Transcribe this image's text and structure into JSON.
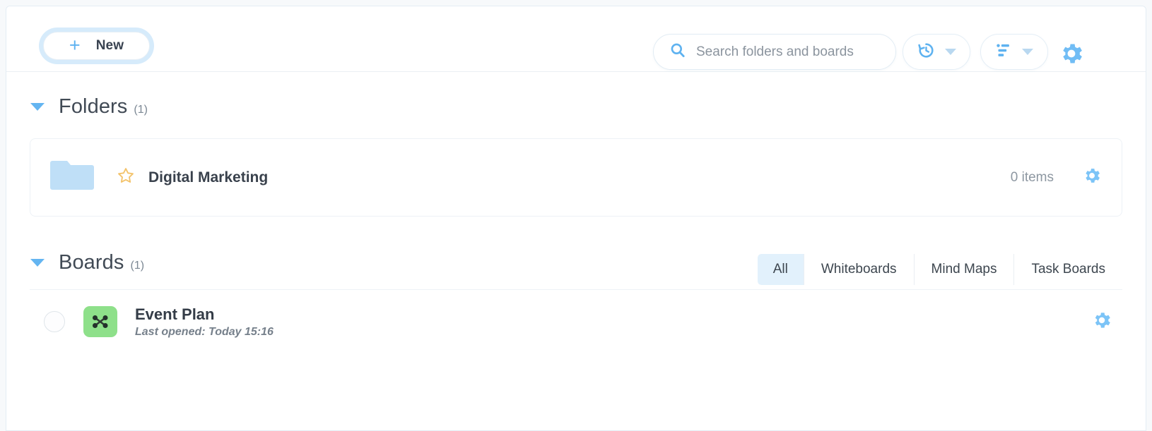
{
  "toolbar": {
    "new_label": "New",
    "new_icon": "plus-icon",
    "search_placeholder": "Search folders and boards",
    "search_value": "",
    "search_icon": "search-icon",
    "history_icon": "history-icon",
    "sort_icon": "sort-icon",
    "settings_icon": "gear-icon",
    "caret_icon": "chevron-down-icon"
  },
  "folders_section": {
    "title": "Folders",
    "count": "(1)",
    "toggle_icon": "caret-down-icon",
    "items": [
      {
        "name": "Digital Marketing",
        "folder_icon": "folder-icon",
        "star_icon": "star-outline-icon",
        "items_count": "0 items",
        "gear_icon": "gear-icon"
      }
    ]
  },
  "boards_section": {
    "title": "Boards",
    "count": "(1)",
    "toggle_icon": "caret-down-icon",
    "filters": [
      {
        "label": "All",
        "active": true
      },
      {
        "label": "Whiteboards",
        "active": false
      },
      {
        "label": "Mind Maps",
        "active": false
      },
      {
        "label": "Task Boards",
        "active": false
      }
    ],
    "items": [
      {
        "name": "Event Plan",
        "subtitle": "Last opened: Today 15:16",
        "type_icon": "mind-map-icon",
        "select_icon": "radio-unchecked-icon",
        "gear_icon": "gear-icon"
      }
    ]
  },
  "colors": {
    "accent": "#5eb2f0",
    "folder": "#bfdff7",
    "star": "#f3c36b",
    "board_tile": "#8ee08a",
    "tab_active_bg": "#e2f1fc",
    "page_bg": "#f7f9fb"
  }
}
